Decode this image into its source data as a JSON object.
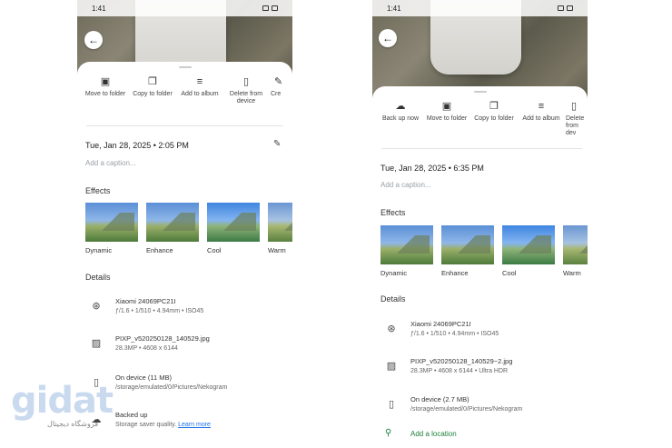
{
  "left": {
    "status_time": "1:41",
    "actions": [
      {
        "icon": "folder-move-icon",
        "label": "Move to folder"
      },
      {
        "icon": "copy-icon",
        "label": "Copy to folder"
      },
      {
        "icon": "playlist-add-icon",
        "label": "Add to album"
      },
      {
        "icon": "delete-device-icon",
        "label": "Delete from device"
      },
      {
        "icon": "create-icon",
        "label": "Cre"
      }
    ],
    "date": "Tue, Jan 28, 2025 • 2:05 PM",
    "caption_placeholder": "Add a caption...",
    "effects_title": "Effects",
    "effects": [
      "Dynamic",
      "Enhance",
      "Cool",
      "Warm"
    ],
    "details_title": "Details",
    "camera_model": "Xiaomi 24069PC21I",
    "camera_specs": "ƒ/1.6 • 1/510 • 4.94mm • ISO45",
    "file_name": "PIXP_v520250128_140529.jpg",
    "file_specs": "28.3MP • 4608 x 6144",
    "storage_title": "On device (11 MB)",
    "storage_path": "/storage/emulated/0/Pictures/Nekogram",
    "backup_title": "Backed up",
    "backup_text": "Storage saver quality.",
    "backup_link": "Learn more"
  },
  "right": {
    "status_time": "1:41",
    "actions": [
      {
        "icon": "cloud-upload-icon",
        "label": "Back up now"
      },
      {
        "icon": "folder-move-icon",
        "label": "Move to folder"
      },
      {
        "icon": "copy-icon",
        "label": "Copy to folder"
      },
      {
        "icon": "playlist-add-icon",
        "label": "Add to album"
      },
      {
        "icon": "delete-device-icon",
        "label": "Delete from dev"
      }
    ],
    "date": "Tue, Jan 28, 2025 • 6:35 PM",
    "caption_placeholder": "Add a caption...",
    "effects_title": "Effects",
    "effects": [
      "Dynamic",
      "Enhance",
      "Cool",
      "Warm"
    ],
    "details_title": "Details",
    "camera_model": "Xiaomi 24069PC21I",
    "camera_specs": "ƒ/1.6 • 1/510 • 4.94mm • ISO45",
    "file_name": "PIXP_v520250128_140529~2.jpg",
    "file_specs": "28.3MP • 4608 x 6144 • Ultra HDR",
    "storage_title": "On device (2.7 MB)",
    "storage_path": "/storage/emulated/0/Pictures/Nekogram",
    "location_label": "Add a location"
  },
  "watermark": {
    "logo": "gidat",
    "tagline": "فروشگاه دیجیتال"
  }
}
